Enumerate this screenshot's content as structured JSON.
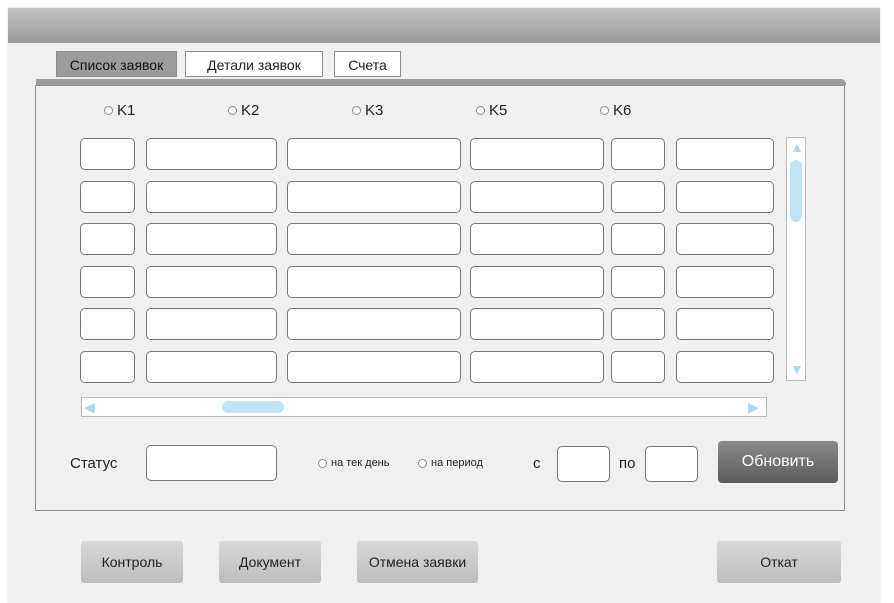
{
  "tabs": [
    "Список заявок",
    "Детали заявок",
    "Счета"
  ],
  "columns": [
    "K1",
    "K2",
    "K3",
    "K5",
    "K6"
  ],
  "grid_rows": 6,
  "filter": {
    "status_label": "Статус",
    "status_value": "",
    "radio_today": "на тек день",
    "radio_period": "на период",
    "from_label": "с",
    "from_value": "",
    "to_label": "по",
    "to_value": "",
    "refresh_label": "Обновить"
  },
  "actions": {
    "control": "Контроль",
    "document": "Документ",
    "cancel_request": "Отмена заявки",
    "rollback": "Откат"
  },
  "colors": {
    "active_tab": "#9c9c9c",
    "scroll_thumb": "#bfe3f7",
    "dark_button": "#6f6f6f"
  }
}
